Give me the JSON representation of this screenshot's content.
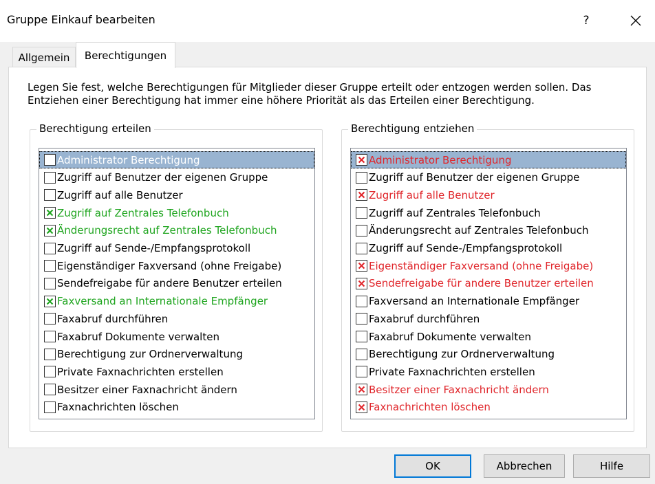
{
  "window": {
    "title": "Gruppe Einkauf bearbeiten",
    "help_label": "?"
  },
  "tabs": [
    {
      "label": "Allgemein",
      "active": false
    },
    {
      "label": "Berechtigungen",
      "active": true
    }
  ],
  "intro_line1": "Legen Sie fest, welche Berechtigungen für Mitglieder dieser Gruppe erteilt oder entzogen werden sollen. Das",
  "intro_line2": "Entziehen einer Berechtigung hat immer eine höhere Priorität als das Erteilen einer Berechtigung.",
  "colors": {
    "granted": "#1fa51f",
    "revoked": "#e0262b",
    "selection": "#99b4d1",
    "focus_border": "#0078d7"
  },
  "grant": {
    "title": "Berechtigung erteilen",
    "items": [
      {
        "label": "Administrator Berechtigung",
        "checked": false,
        "selected": true
      },
      {
        "label": "Zugriff auf Benutzer der eigenen Gruppe",
        "checked": false
      },
      {
        "label": "Zugriff auf alle Benutzer",
        "checked": false
      },
      {
        "label": "Zugriff auf Zentrales Telefonbuch",
        "checked": true
      },
      {
        "label": "Änderungsrecht auf Zentrales Telefonbuch",
        "checked": true
      },
      {
        "label": "Zugriff auf Sende-/Empfangsprotokoll",
        "checked": false
      },
      {
        "label": "Eigenständiger Faxversand (ohne Freigabe)",
        "checked": false
      },
      {
        "label": "Sendefreigabe für andere Benutzer erteilen",
        "checked": false
      },
      {
        "label": "Faxversand an Internationale Empfänger",
        "checked": true
      },
      {
        "label": "Faxabruf durchführen",
        "checked": false
      },
      {
        "label": "Faxabruf Dokumente verwalten",
        "checked": false
      },
      {
        "label": "Berechtigung zur Ordnerverwaltung",
        "checked": false
      },
      {
        "label": "Private Faxnachrichten erstellen",
        "checked": false
      },
      {
        "label": "Besitzer einer Faxnachricht ändern",
        "checked": false
      },
      {
        "label": "Faxnachrichten löschen",
        "checked": false
      }
    ]
  },
  "revoke": {
    "title": "Berechtigung entziehen",
    "items": [
      {
        "label": "Administrator Berechtigung",
        "checked": true,
        "selected": true
      },
      {
        "label": "Zugriff auf Benutzer der eigenen Gruppe",
        "checked": false
      },
      {
        "label": "Zugriff auf alle Benutzer",
        "checked": true
      },
      {
        "label": "Zugriff auf Zentrales Telefonbuch",
        "checked": false
      },
      {
        "label": "Änderungsrecht auf Zentrales Telefonbuch",
        "checked": false
      },
      {
        "label": "Zugriff auf Sende-/Empfangsprotokoll",
        "checked": false
      },
      {
        "label": "Eigenständiger Faxversand (ohne Freigabe)",
        "checked": true
      },
      {
        "label": "Sendefreigabe für andere Benutzer erteilen",
        "checked": true
      },
      {
        "label": "Faxversand an Internationale Empfänger",
        "checked": false
      },
      {
        "label": "Faxabruf durchführen",
        "checked": false
      },
      {
        "label": "Faxabruf Dokumente verwalten",
        "checked": false
      },
      {
        "label": "Berechtigung zur Ordnerverwaltung",
        "checked": false
      },
      {
        "label": "Private Faxnachrichten erstellen",
        "checked": false
      },
      {
        "label": "Besitzer einer Faxnachricht ändern",
        "checked": true
      },
      {
        "label": "Faxnachrichten löschen",
        "checked": true
      }
    ]
  },
  "buttons": {
    "ok": "OK",
    "cancel": "Abbrechen",
    "help": "Hilfe"
  }
}
